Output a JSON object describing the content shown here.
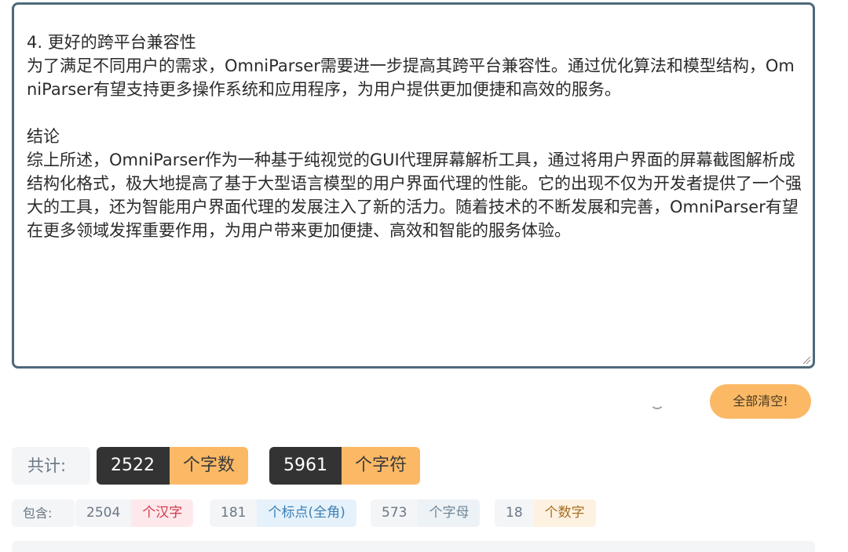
{
  "editor": {
    "text": "域，如虚拟现实、增强现实、游戏开发等。\n\n4. 更好的跨平台兼容性\n为了满足不同用户的需求，OmniParser需要进一步提高其跨平台兼容性。通过优化算法和模型结构，OmniParser有望支持更多操作系统和应用程序，为用户提供更加便捷和高效的服务。\n\n结论\n综上所述，OmniParser作为一种基于纯视觉的GUI代理屏幕解析工具，通过将用户界面的屏幕截图解析成结构化格式，极大地提高了基于大型语言模型的用户界面代理的性能。它的出现不仅为开发者提供了一个强大的工具，还为智能用户界面代理的发展注入了新的活力。随着技术的不断发展和完善，OmniParser有望在更多领域发挥重要作用，为用户带来更加便捷、高效和智能的服务体验。"
  },
  "actions": {
    "clear_label": "全部清空!"
  },
  "totals": {
    "label": "共计:",
    "char_count": "2522",
    "char_unit": "个字数",
    "symbol_count": "5961",
    "symbol_unit": "个字符"
  },
  "includes": {
    "label": "包含:",
    "han_count": "2504",
    "han_unit": "个汉字",
    "punct_count": "181",
    "punct_unit": "个标点(全角)",
    "letter_count": "573",
    "letter_unit": "个字母",
    "digit_count": "18",
    "digit_unit": "个数字"
  },
  "colors": {
    "accent": "#fbb966",
    "dark": "#333333",
    "border": "#4e6a7a"
  }
}
